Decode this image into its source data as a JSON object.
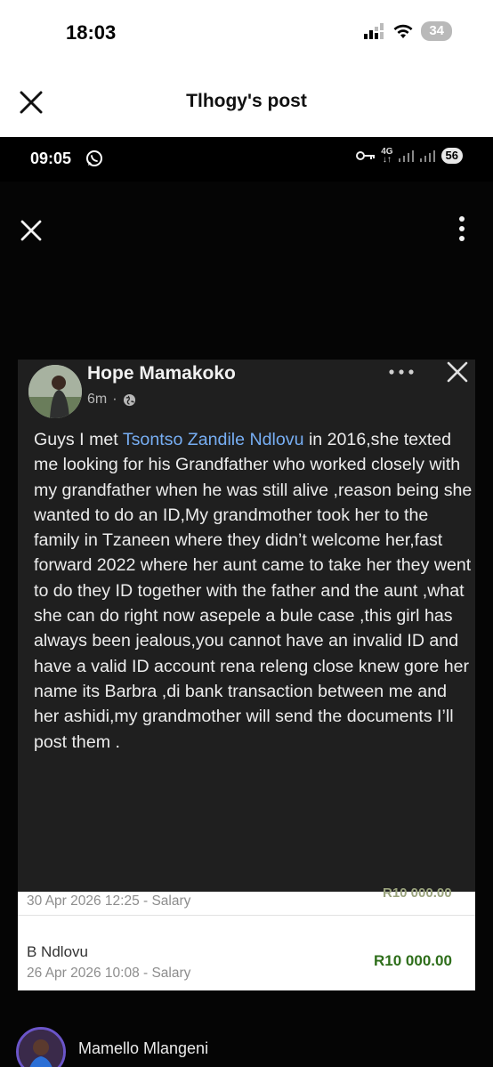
{
  "outer_status": {
    "time": "18:03",
    "battery": "34"
  },
  "outer_header": {
    "title": "Tlhogy's post"
  },
  "inner_status": {
    "time": "09:05",
    "network": "4G",
    "battery": "56"
  },
  "post": {
    "author": "Hope Mamakoko",
    "time_ago": "6m",
    "privacy_icon": "globe-icon",
    "text_before_mention": "Guys I met ",
    "mention": "Tsontso Zandile Ndlovu",
    "text_after_mention": " in 2016,she texted me looking for his Grandfather who worked closely with my grandfather when he was still alive ,reason being she wanted to do an ID,My grandmother took her to the family in Tzaneen where they didn’t welcome her,fast forward 2022 where her aunt came to take her they went to do they ID together with the father and the aunt ,what she can do right now asepele a bule case ,this girl has always been jealous,you cannot  have an invalid ID and have a valid ID account rena releng close knew gore her name its Barbra ,di bank transaction between me and her ashidi,my grandmother will send the documents I’ll post them ."
  },
  "receipt": {
    "top_partial_date": "30 Apr 2026 12:25 - Salary",
    "top_partial_amount": "R10 000.00",
    "name": "B Ndlovu",
    "date": "26 Apr 2026 10:08 - Salary",
    "amount": "R10 000.00",
    "amount_color": "#2e6e1a"
  },
  "comment": {
    "author": "Mamello Mlangeni"
  }
}
